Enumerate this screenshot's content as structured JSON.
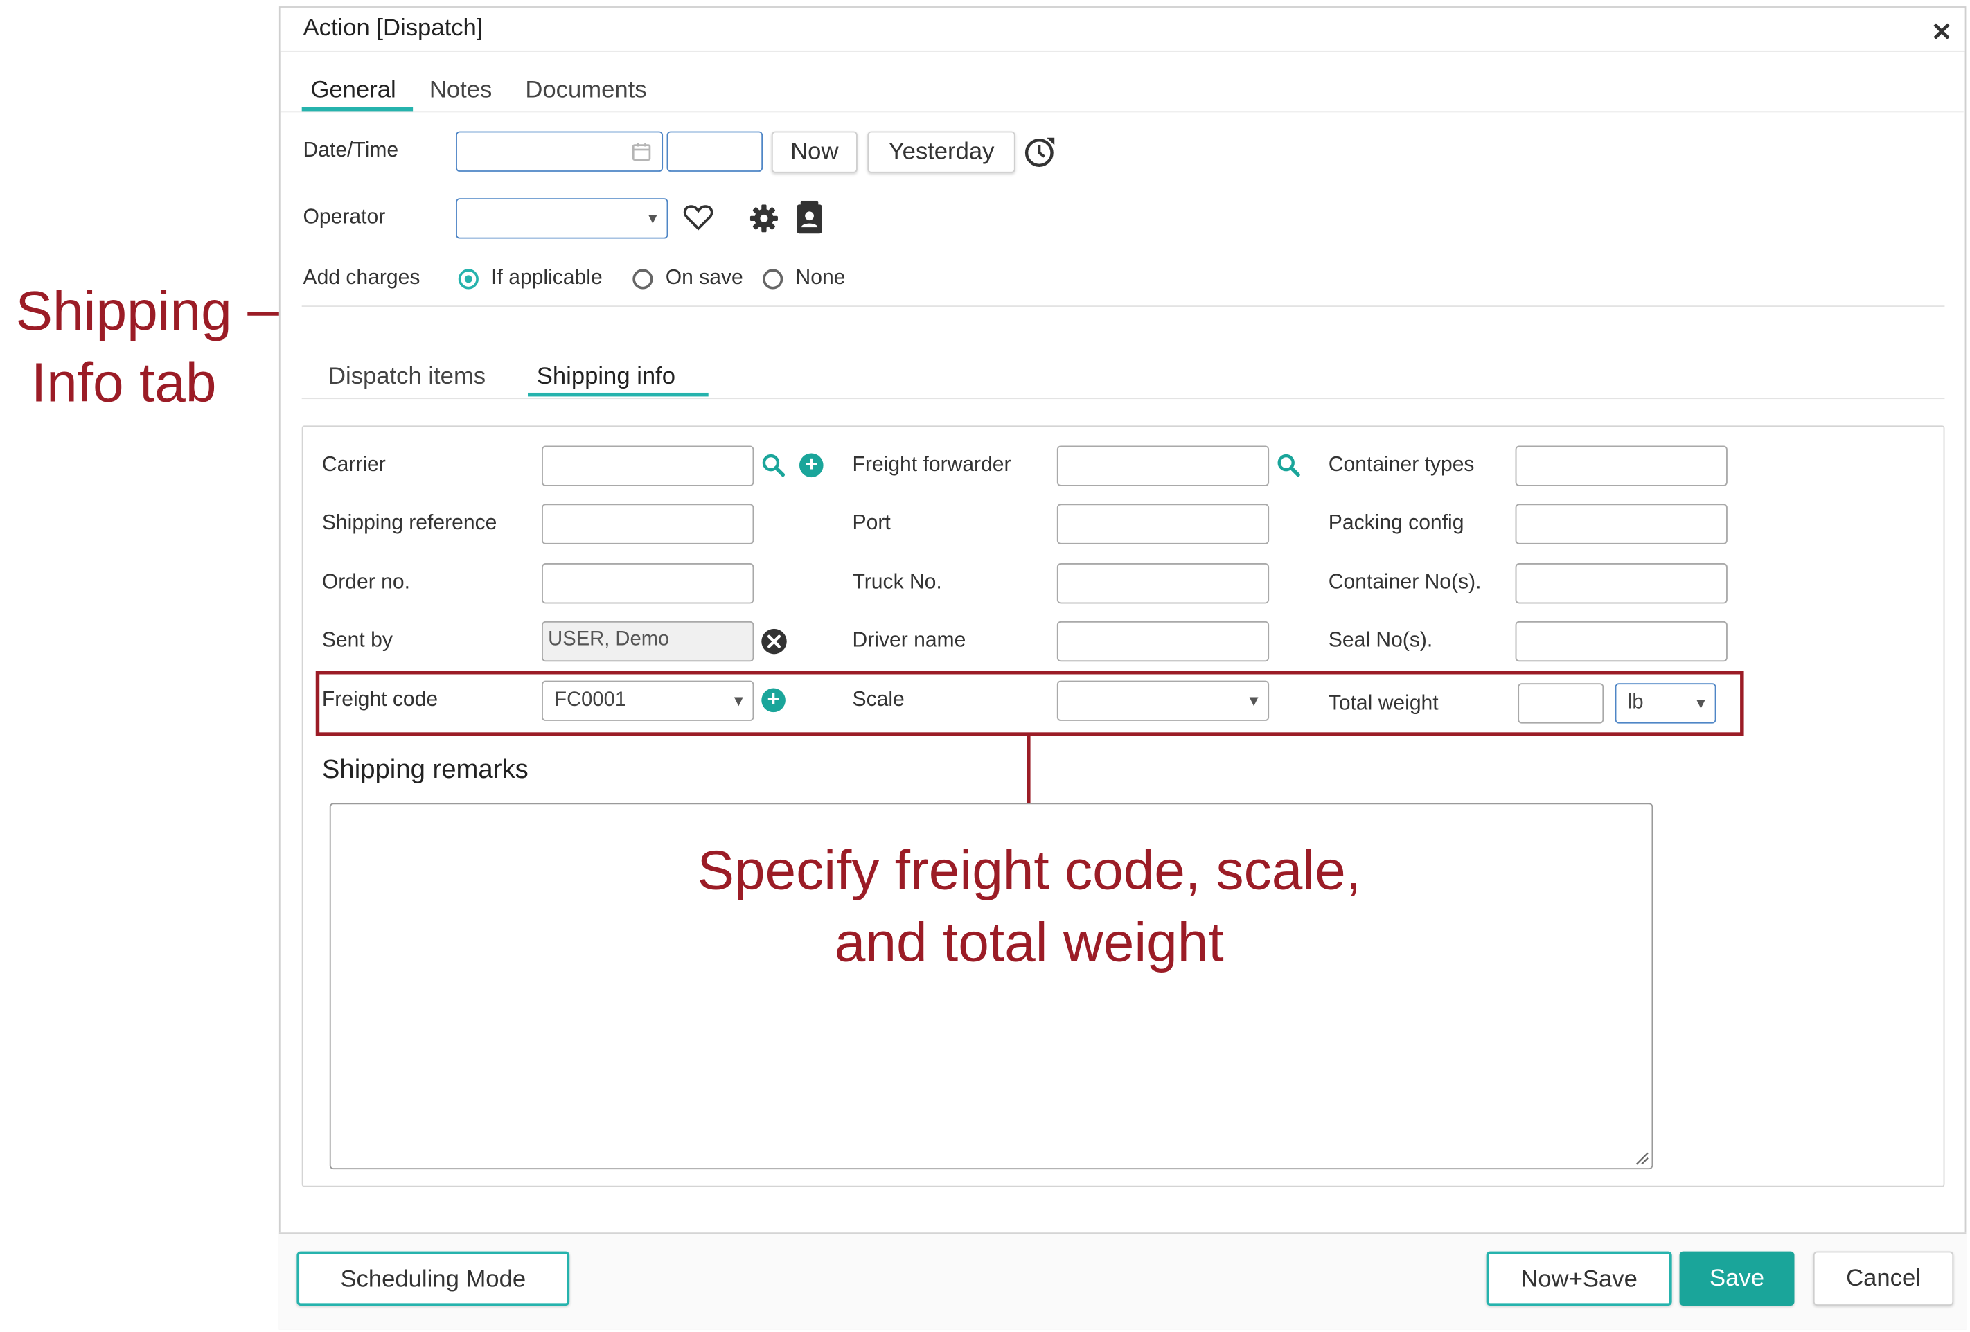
{
  "dialog": {
    "title": "Action [Dispatch]",
    "close": "✕"
  },
  "tabs": [
    {
      "label": "General",
      "active": true
    },
    {
      "label": "Notes"
    },
    {
      "label": "Documents"
    }
  ],
  "general": {
    "datetime_label": "Date/Time",
    "date_value": "",
    "time_value": "",
    "now_button": "Now",
    "yesterday_button": "Yesterday",
    "operator_label": "Operator",
    "operator_value": "",
    "add_charges_label": "Add charges",
    "add_charges_options": [
      "If applicable",
      "On save",
      "None"
    ],
    "add_charges_selected": "If applicable"
  },
  "subtabs": [
    {
      "label": "Dispatch items"
    },
    {
      "label": "Shipping info",
      "active": true
    }
  ],
  "shipping": {
    "carrier_label": "Carrier",
    "shipping_reference_label": "Shipping reference",
    "order_no_label": "Order no.",
    "sent_by_label": "Sent by",
    "sent_by_value": "USER, Demo",
    "freight_code_label": "Freight code",
    "freight_code_value": "FC0001",
    "freight_forwarder_label": "Freight forwarder",
    "port_label": "Port",
    "truck_no_label": "Truck No.",
    "driver_name_label": "Driver name",
    "scale_label": "Scale",
    "scale_value": "",
    "container_types_label": "Container types",
    "packing_config_label": "Packing config",
    "container_nos_label": "Container No(s).",
    "seal_nos_label": "Seal No(s).",
    "total_weight_label": "Total weight",
    "total_weight_value": "",
    "weight_unit_value": "lb",
    "remarks_label": "Shipping remarks",
    "remarks_value": ""
  },
  "footer": {
    "scheduling_mode": "Scheduling Mode",
    "now_save": "Now+Save",
    "save": "Save",
    "cancel": "Cancel"
  },
  "annotations": {
    "tab_callout_line1": "Shipping",
    "tab_callout_line2": "Info tab",
    "fields_callout_line1": "Specify freight code, scale,",
    "fields_callout_line2": "and total weight"
  },
  "colors": {
    "accent": "#26b3ad",
    "save_button": "#1aa59a",
    "annotation": "#9b1c26",
    "input_focus": "#4f86c6"
  },
  "icons": [
    "close-icon",
    "calendar-icon",
    "clock-icon",
    "heart-icon",
    "gear-icon",
    "contact-card-icon",
    "search-icon",
    "add-icon",
    "clear-icon",
    "dropdown-arrow-icon",
    "resize-handle-icon"
  ]
}
